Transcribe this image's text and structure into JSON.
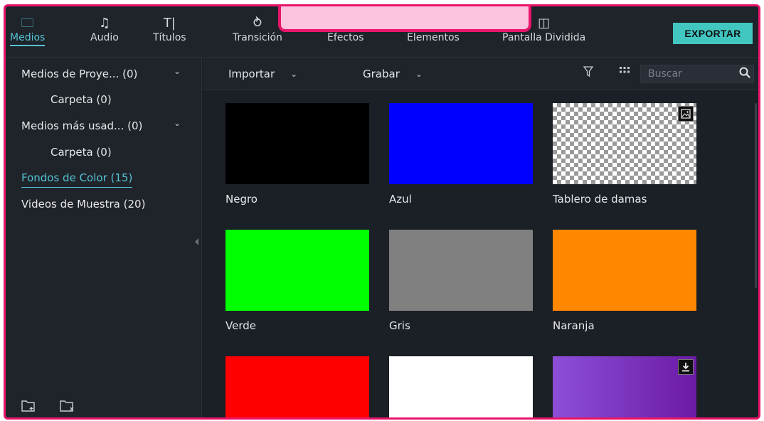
{
  "toolbar": {
    "tabs": [
      {
        "label": "Medios",
        "icon": "folder-icon",
        "glyph": "🗀"
      },
      {
        "label": "Audio",
        "icon": "music-note-icon",
        "glyph": "♫"
      },
      {
        "label": "Títulos",
        "icon": "text-cursor-icon",
        "glyph": "T|"
      },
      {
        "label": "Transición",
        "icon": "transition-icon",
        "glyph": "⥁"
      },
      {
        "label": "Efectos",
        "icon": "effects-icon",
        "glyph": "✦"
      },
      {
        "label": "Elementos",
        "icon": "elements-icon",
        "glyph": "▭"
      },
      {
        "label": "Pantalla Dividida",
        "icon": "split-screen-icon",
        "glyph": "◫"
      }
    ],
    "active_tab": "Medios",
    "export_label": "EXPORTAR"
  },
  "sidebar": {
    "items": [
      {
        "label": "Medios de Proye... (0)",
        "chevron": "⌄"
      },
      {
        "label": "Carpeta (0)"
      },
      {
        "label": "Medios más usad... (0)",
        "chevron": "⌄"
      },
      {
        "label": "Carpeta (0)"
      },
      {
        "label": "Fondos de Color (15)",
        "active": true
      },
      {
        "label": "Videos de Muestra (20)"
      }
    ],
    "footer_icons": [
      "new-folder-icon",
      "delete-folder-icon"
    ]
  },
  "content_toolbar": {
    "import_label": "Importar",
    "record_label": "Grabar",
    "caret": "⌄",
    "filter_icon": "filter-icon",
    "grid_icon": "grid-view-icon",
    "search_placeholder": "Buscar"
  },
  "media": [
    {
      "label": "Negro",
      "color": "#000000"
    },
    {
      "label": "Azul",
      "color": "#0000ff"
    },
    {
      "label": "Tablero de damas",
      "color": "checker",
      "badge": "image-icon"
    },
    {
      "label": "Verde",
      "color": "#00ff00"
    },
    {
      "label": "Gris",
      "color": "#808080"
    },
    {
      "label": "Naranja",
      "color": "#ff8800"
    },
    {
      "label": "",
      "color": "#ff0000"
    },
    {
      "label": "",
      "color": "#ffffff"
    },
    {
      "label": "",
      "color": "gradient-purple",
      "badge": "download-icon"
    }
  ],
  "colors": {
    "accent": "#55c4d4",
    "export_button": "#41c6c0",
    "frame_pink": "#e8156a",
    "overlay_pink": "#fbc3dd"
  }
}
